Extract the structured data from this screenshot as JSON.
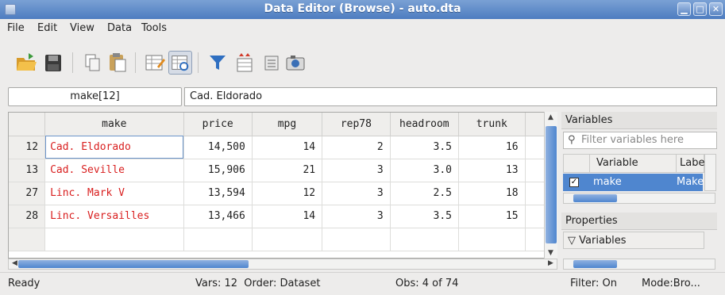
{
  "window": {
    "title": "Data Editor (Browse) - auto.dta"
  },
  "menu": [
    "File",
    "Edit",
    "View",
    "Data",
    "Tools"
  ],
  "cell": {
    "ref": "make[12]",
    "value": "Cad. Eldorado"
  },
  "grid": {
    "columns": [
      "make",
      "price",
      "mpg",
      "rep78",
      "headroom",
      "trunk"
    ],
    "rows": [
      {
        "num": "12",
        "make": "Cad. Eldorado",
        "price": "14,500",
        "mpg": "14",
        "rep78": "2",
        "headroom": "3.5",
        "trunk": "16"
      },
      {
        "num": "13",
        "make": "Cad. Seville",
        "price": "15,906",
        "mpg": "21",
        "rep78": "3",
        "headroom": "3.0",
        "trunk": "13"
      },
      {
        "num": "27",
        "make": "Linc. Mark V",
        "price": "13,594",
        "mpg": "12",
        "rep78": "3",
        "headroom": "2.5",
        "trunk": "18"
      },
      {
        "num": "28",
        "make": "Linc. Versailles",
        "price": "13,466",
        "mpg": "14",
        "rep78": "3",
        "headroom": "3.5",
        "trunk": "15"
      }
    ]
  },
  "variables_panel": {
    "title": "Variables",
    "filter_placeholder": "Filter variables here",
    "col_variable": "Variable",
    "col_label": "Label",
    "row_variable": "make",
    "row_label": "Make"
  },
  "properties_panel": {
    "title": "Properties",
    "section": "Variables"
  },
  "status": {
    "ready": "Ready",
    "vars": "Vars: 12  Order: Dataset",
    "obs": "Obs: 4 of 74",
    "filter": "Filter: On",
    "mode": "Mode:Bro..."
  },
  "colors": {
    "string_text": "#d91f1f",
    "accent": "#4f86cf",
    "titlebar": "#5a86c6"
  }
}
